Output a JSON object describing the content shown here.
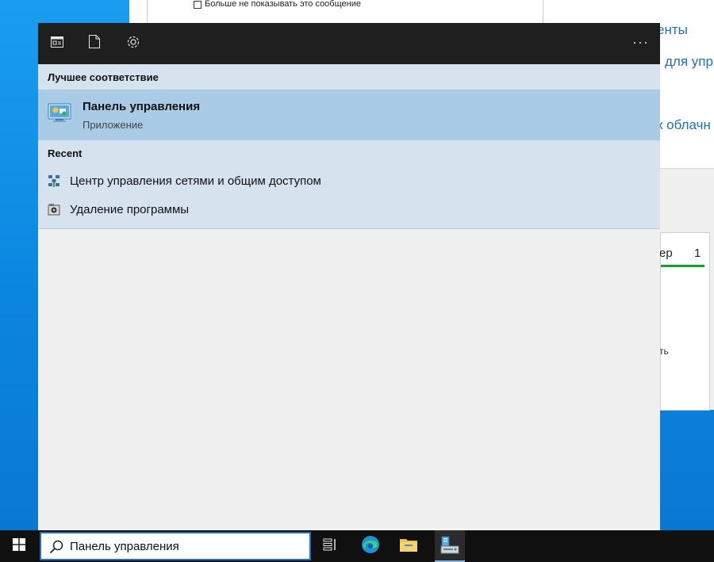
{
  "background_window": {
    "checkbox_label": "Больше не показывать это сообщение",
    "link_1": "енты",
    "link_2": "для упр",
    "link_3": "к облачн",
    "card_text": "ер",
    "card_number": "1",
    "card_small": "ть"
  },
  "header": {
    "more_label": "···",
    "icons": [
      "app-icon",
      "document-icon",
      "settings-icon"
    ]
  },
  "results": {
    "best_match_heading": "Лучшее соответствие",
    "best_match": {
      "title": "Панель управления",
      "subtitle": "Приложение",
      "icon": "control-panel-icon"
    },
    "recent_heading": "Recent",
    "recent_items": [
      {
        "label": "Центр управления сетями и общим доступом",
        "icon": "network-icon"
      },
      {
        "label": "Удаление программы",
        "icon": "programs-icon"
      }
    ]
  },
  "taskbar": {
    "search_value": "Панель управления",
    "icons": [
      "windows-start-icon",
      "search-icon",
      "task-view-icon",
      "edge-icon",
      "file-explorer-icon",
      "server-manager-icon"
    ]
  },
  "colors": {
    "header_bg": "#1f1f1f",
    "results_bg": "#d6e3ee",
    "best_match_bg": "#a9cbe6",
    "taskbar_bg": "#101010",
    "accent": "#1a73c7"
  }
}
